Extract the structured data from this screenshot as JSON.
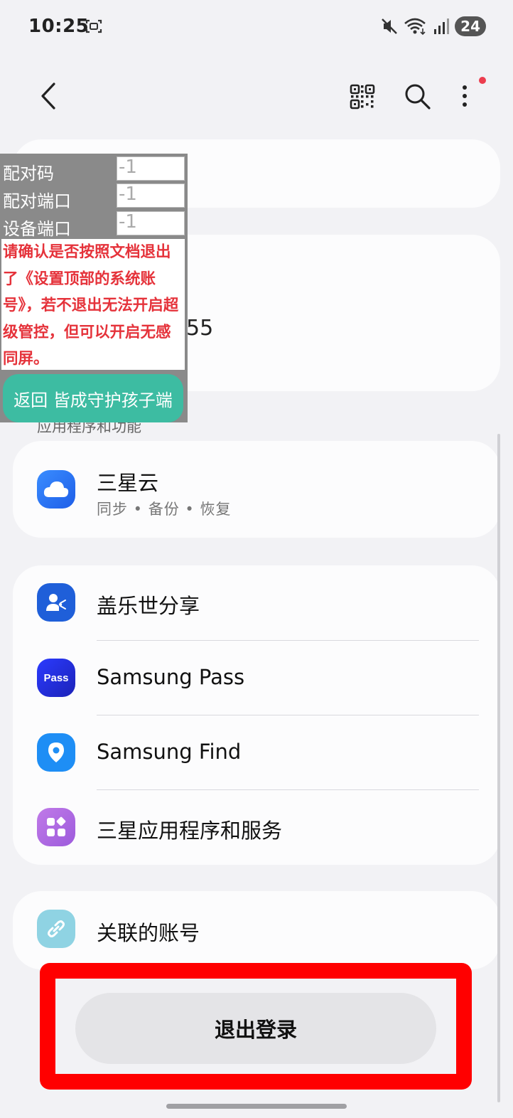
{
  "status_bar": {
    "time": "10:25",
    "battery": "24",
    "icons": [
      "screenshot-icon",
      "mute-icon",
      "wifi-icon",
      "signal-icon"
    ]
  },
  "app_bar": {
    "icons": [
      "back-icon",
      "qr-code-icon",
      "search-icon",
      "more-options-icon"
    ]
  },
  "account": {
    "partial_text": "55"
  },
  "section_label": "应用程序和功能",
  "cloud_card": {
    "title": "三星云",
    "subtitle": "同步 • 备份 • 恢复",
    "icon": "cloud-icon"
  },
  "apps_card": {
    "items": [
      {
        "title": "盖乐世分享",
        "icon": "share-icon"
      },
      {
        "title": "Samsung Pass",
        "icon": "pass-icon",
        "icon_text": "Pass"
      },
      {
        "title": "Samsung Find",
        "icon": "location-pin-icon"
      },
      {
        "title": "三星应用程序和服务",
        "icon": "apps-grid-icon"
      }
    ]
  },
  "linked_card": {
    "title": "关联的账号",
    "icon": "link-icon"
  },
  "logout": {
    "label": "退出登录"
  },
  "overlay": {
    "fields": [
      {
        "label": "配对码",
        "value": "-1"
      },
      {
        "label": "配对端口",
        "value": "-1"
      },
      {
        "label": "设备端口",
        "value": "-1"
      }
    ],
    "warning": "请确认是否按照文档退出了《设置顶部的系统账号》，若不退出无法开启超级管控，但可以开启无感同屏。",
    "button_label": "返回 皆成守护孩子端"
  },
  "colors": {
    "background": "#f2f2f5",
    "card": "#fcfcfd",
    "highlight": "#ff0000",
    "warning_text": "#e5323a",
    "overlay_button": "#3dbca2"
  }
}
